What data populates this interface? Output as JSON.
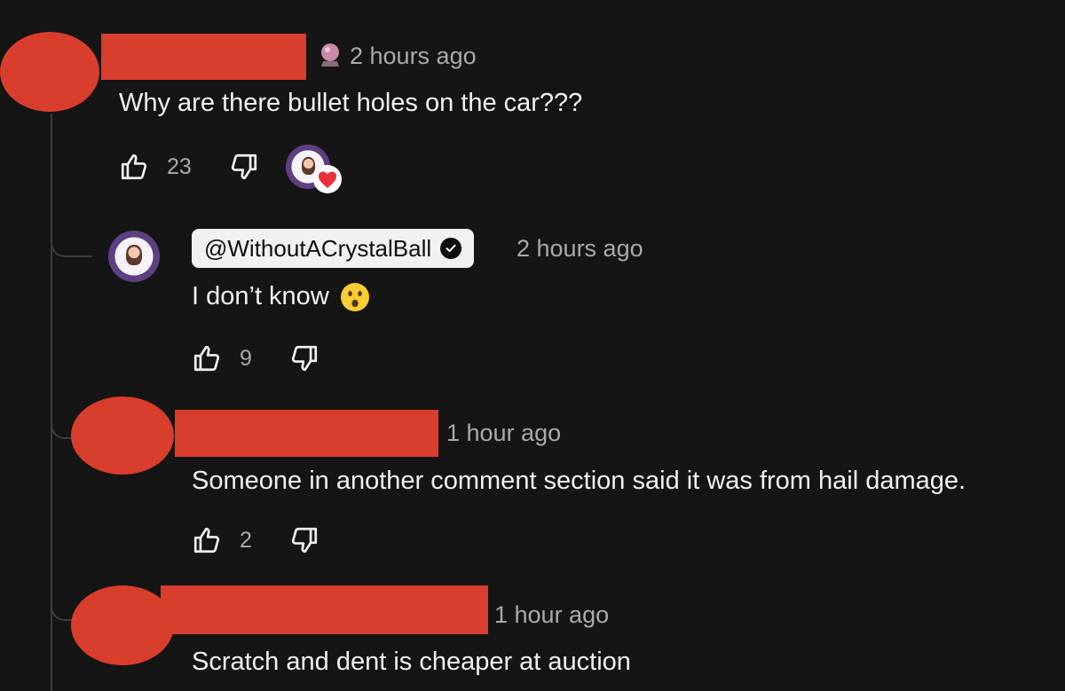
{
  "thread": {
    "top_comment": {
      "time": "2 hours ago",
      "text": "Why are there bullet holes on the car???",
      "likes": "23",
      "creator_hearted": true
    },
    "replies": [
      {
        "handle": "@WithoutACrystalBall",
        "verified": true,
        "time": "2 hours ago",
        "text": "I don’t know",
        "emoji": "astonished-face",
        "likes": "9"
      },
      {
        "time": "1 hour ago",
        "text": "Someone in another comment section said it was from hail damage.",
        "likes": "2"
      },
      {
        "time": "1 hour ago",
        "text": "Scratch and dent is cheaper at auction"
      }
    ]
  },
  "colors": {
    "background": "#151515",
    "redaction": "#d93d2c",
    "primary_text": "#f1f1f1",
    "secondary_text": "#aaaaaa",
    "thread_line": "#3c3c3c"
  },
  "icons": [
    "like-icon",
    "dislike-icon",
    "heart-icon",
    "verified-check-icon",
    "crystal-ball-icon",
    "astonished-emoji-icon"
  ]
}
